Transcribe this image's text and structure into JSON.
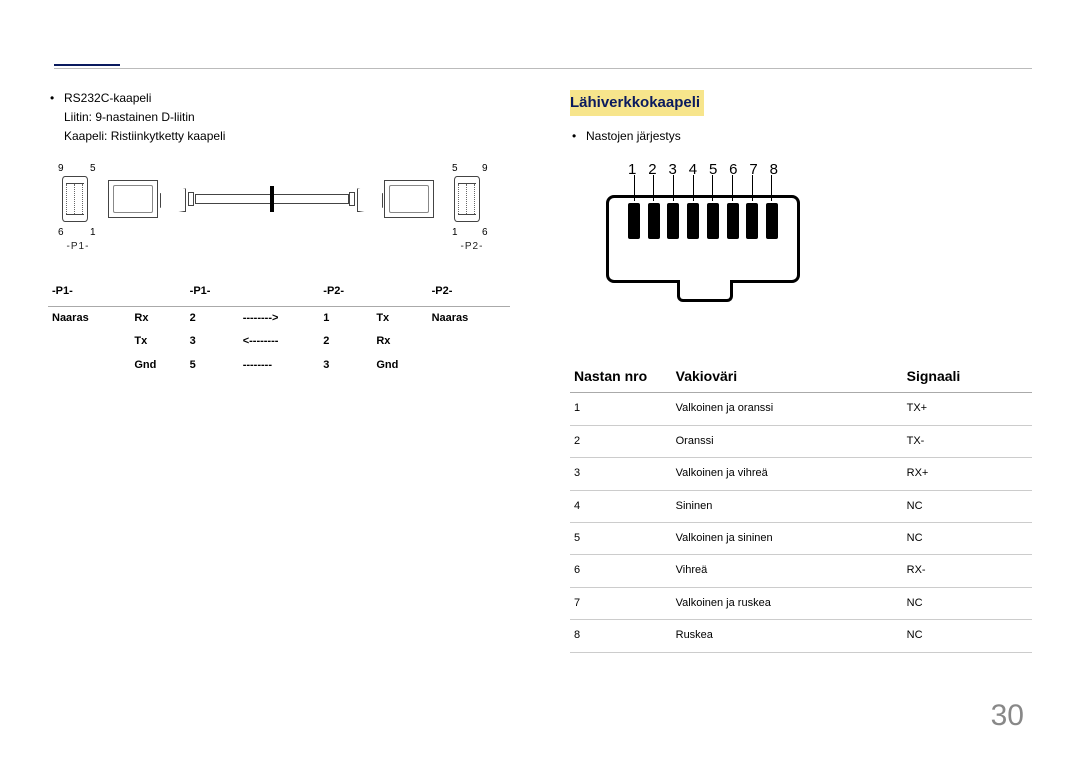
{
  "page_number": "30",
  "left": {
    "bullet_title": "RS232C-kaapeli",
    "line1": "Liitin: 9-nastainen D-liitin",
    "line2": "Kaapeli: Ristiinkytketty kaapeli",
    "pin_top_left_a": "9",
    "pin_top_left_b": "5",
    "pin_bot_left_a": "6",
    "pin_bot_left_b": "1",
    "pin_top_right_a": "5",
    "pin_top_right_b": "9",
    "pin_bot_right_a": "1",
    "pin_bot_right_b": "6",
    "sub_left": "-P1-",
    "sub_right": "-P2-",
    "table": {
      "h1": "-P1-",
      "h2": "-P1-",
      "h3": "-P2-",
      "h4": "-P2-",
      "rows": [
        {
          "a": "Naaras",
          "b": "Rx",
          "c": "2",
          "d": "-------->",
          "e": "1",
          "f": "Tx",
          "g": "Naaras"
        },
        {
          "a": "",
          "b": "Tx",
          "c": "3",
          "d": "<--------",
          "e": "2",
          "f": "Rx",
          "g": ""
        },
        {
          "a": "",
          "b": "Gnd",
          "c": "5",
          "d": "--------",
          "e": "3",
          "f": "Gnd",
          "g": ""
        }
      ]
    }
  },
  "right": {
    "section_title": "Lähiverkkokaapeli",
    "bullet": "Nastojen järjestys",
    "pin_numbers": [
      "1",
      "2",
      "3",
      "4",
      "5",
      "6",
      "7",
      "8"
    ],
    "table": {
      "h1": "Nastan nro",
      "h2": "Vakioväri",
      "h3": "Signaali",
      "rows": [
        {
          "n": "1",
          "c": "Valkoinen ja oranssi",
          "s": "TX+"
        },
        {
          "n": "2",
          "c": "Oranssi",
          "s": "TX-"
        },
        {
          "n": "3",
          "c": "Valkoinen ja vihreä",
          "s": "RX+"
        },
        {
          "n": "4",
          "c": "Sininen",
          "s": "NC"
        },
        {
          "n": "5",
          "c": "Valkoinen ja sininen",
          "s": "NC"
        },
        {
          "n": "6",
          "c": "Vihreä",
          "s": "RX-"
        },
        {
          "n": "7",
          "c": "Valkoinen ja ruskea",
          "s": "NC"
        },
        {
          "n": "8",
          "c": "Ruskea",
          "s": "NC"
        }
      ]
    }
  }
}
